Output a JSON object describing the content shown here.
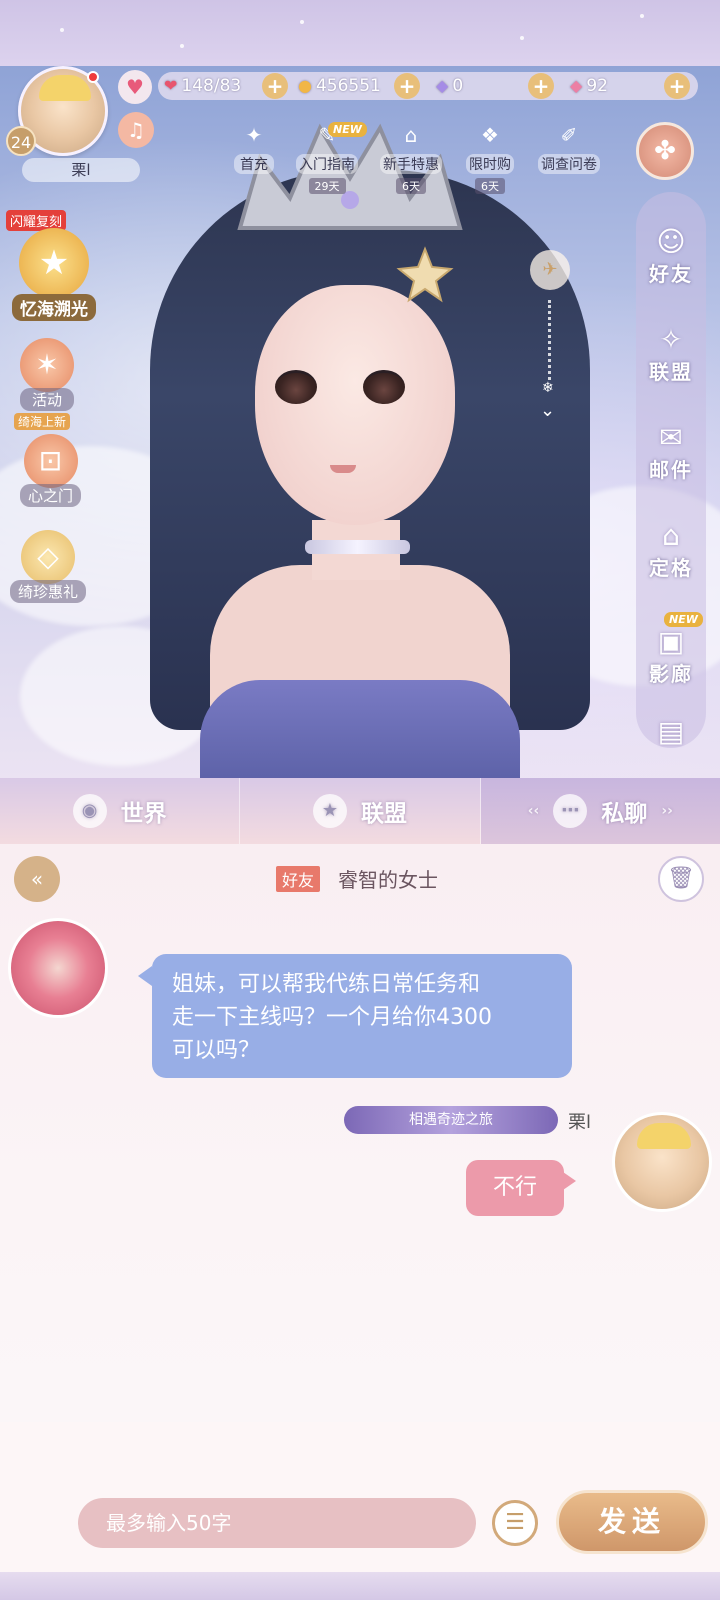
{
  "hud": {
    "level": "24",
    "player_name": "栗l",
    "stamina": "148/83",
    "gold": "456551",
    "crystal": "0",
    "diamond": "92"
  },
  "top_menu": [
    {
      "label": "首充",
      "icon": "gift-box-icon"
    },
    {
      "label": "入门指南",
      "icon": "guide-icon",
      "badge": "NEW",
      "timer": "29天"
    },
    {
      "label": "新手特惠",
      "icon": "bag-icon",
      "timer": "6天"
    },
    {
      "label": "限时购",
      "icon": "gift-icon",
      "timer": "6天"
    },
    {
      "label": "调查问卷",
      "icon": "survey-icon"
    }
  ],
  "left_menu": {
    "flash_tag": "闪耀复刻",
    "memory": "忆海溯光",
    "activity": "活动",
    "sea_tag": "绮海上新",
    "heart_gate": "心之门",
    "deal": "绮珍惠礼"
  },
  "side_menu": [
    {
      "label": "好友",
      "icon": "friend-icon"
    },
    {
      "label": "联盟",
      "icon": "alliance-icon"
    },
    {
      "label": "邮件",
      "icon": "mail-icon"
    },
    {
      "label": "定格",
      "icon": "home-icon"
    },
    {
      "label": "影廊",
      "icon": "camera-icon",
      "badge": "NEW"
    }
  ],
  "tabs": [
    {
      "label": "世界",
      "icon": "globe-icon"
    },
    {
      "label": "联盟",
      "icon": "shield-icon"
    },
    {
      "label": "私聊",
      "icon": "chat-icon"
    }
  ],
  "chat": {
    "friend_tag": "好友",
    "title": "睿智的女士",
    "incoming": {
      "line1": "姐妹，可以帮我代练日常任务和",
      "line2": "走一下主线吗？一个月给你4300",
      "line3": "可以吗？"
    },
    "outgoing": {
      "title_badge": "相遇奇迹之旅",
      "sender": "栗l",
      "text": "不行"
    }
  },
  "input": {
    "placeholder": "最多输入50字",
    "send_label": "发送"
  },
  "colors": {
    "incoming_bubble": "#98aee6",
    "outgoing_bubble": "#ec9aaa",
    "send_button": "#d9a574"
  }
}
